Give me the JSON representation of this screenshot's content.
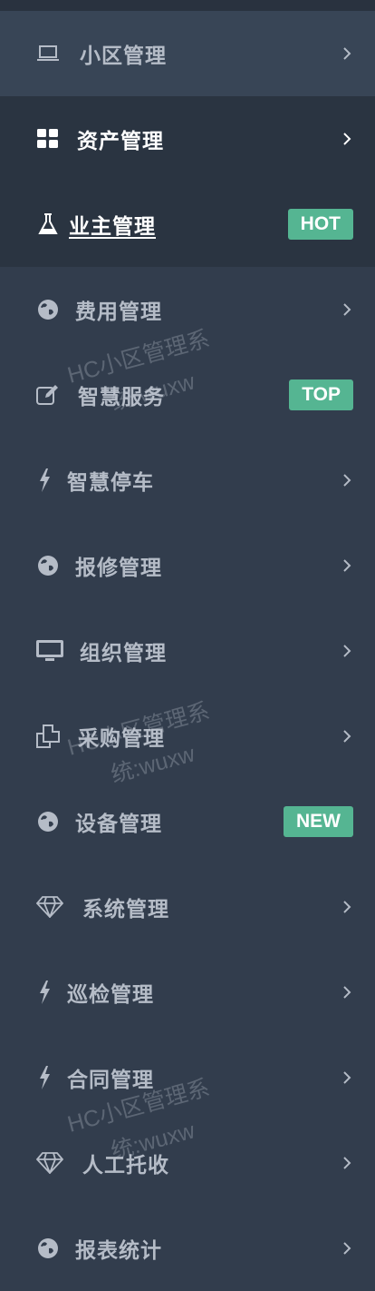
{
  "menu": {
    "items": [
      {
        "label": "小区管理",
        "icon": "laptop-icon",
        "chevron": true
      },
      {
        "label": "资产管理",
        "icon": "grid-icon",
        "chevron": true
      },
      {
        "label": "业主管理",
        "icon": "flask-icon",
        "badge": "HOT"
      },
      {
        "label": "费用管理",
        "icon": "globe-icon",
        "chevron": true
      },
      {
        "label": "智慧服务",
        "icon": "edit-icon",
        "badge": "TOP"
      },
      {
        "label": "智慧停车",
        "icon": "bolt-icon",
        "chevron": true
      },
      {
        "label": "报修管理",
        "icon": "globe-icon",
        "chevron": true
      },
      {
        "label": "组织管理",
        "icon": "monitor-icon",
        "chevron": true
      },
      {
        "label": "采购管理",
        "icon": "copy-icon",
        "chevron": true
      },
      {
        "label": "设备管理",
        "icon": "globe-icon",
        "badge": "NEW"
      },
      {
        "label": "系统管理",
        "icon": "diamond-icon",
        "chevron": true
      },
      {
        "label": "巡检管理",
        "icon": "bolt-icon",
        "chevron": true
      },
      {
        "label": "合同管理",
        "icon": "bolt-icon",
        "chevron": true
      },
      {
        "label": "人工托收",
        "icon": "diamond-icon",
        "chevron": true
      },
      {
        "label": "报表统计",
        "icon": "globe-icon",
        "chevron": true
      }
    ]
  },
  "watermark": {
    "line1": "HC小区管理系",
    "line2": "统:wuxw"
  },
  "colors": {
    "background": "#323d4d",
    "active": "#2a3441",
    "highlight": "#384556",
    "badge": "#55b592"
  }
}
